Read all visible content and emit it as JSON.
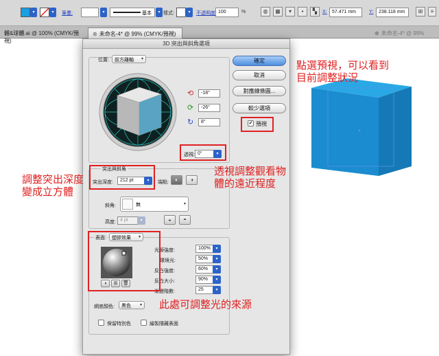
{
  "control_bar": {
    "stroke_label": "筆畫:",
    "stroke_weight_value": "",
    "style_value": "基本",
    "style_label": "樣式:",
    "opacity_label": "不透明度",
    "opacity_value": "100",
    "opacity_unit": "%",
    "x_label": "X:",
    "x_value": "57.471 mm",
    "y_label": "Y:",
    "y_value": "238.118 mm",
    "fill_color": "#1a9fe0"
  },
  "tabs": [
    {
      "label": "體&球體.ai @ 100% (CMYK/預視)"
    },
    {
      "label": "未命名-4* @ 99% (CMYK/預視)"
    },
    {
      "label": "未命名-4* @ 99%"
    }
  ],
  "dialog": {
    "title": "3D 突出與斜角選項",
    "position_label": "位置:",
    "position_value": "前方離軸",
    "rotation_x": "-18°",
    "rotation_y": "-26°",
    "rotation_z": "8°",
    "perspective_label": "透視:",
    "perspective_value": "0°",
    "extrude_group_label": "突出與斜角",
    "extrude_depth_label": "突出深度:",
    "extrude_depth_value": "212 pt",
    "cap_label": "端點:",
    "bevel_label": "斜角:",
    "bevel_value": "無",
    "height_label": "高度:",
    "height_value": "4 pt",
    "surface_label": "表面:",
    "surface_value": "塑膠效果",
    "light_intensity_label": "光源強度:",
    "light_intensity_value": "100%",
    "ambient_label": "環境光:",
    "ambient_value": "50%",
    "highlight_intensity_label": "反白強度:",
    "highlight_intensity_value": "60%",
    "highlight_size_label": "反白大小:",
    "highlight_size_value": "90%",
    "blend_steps_label": "漸變階數:",
    "blend_steps_value": "25",
    "shading_color_label": "網底顏色:",
    "shading_color_value": "黑色",
    "preserve_spot_label": "保留特別色",
    "draw_hidden_label": "繪製隱藏表面",
    "ok_label": "確定",
    "cancel_label": "取消",
    "map_art_label": "對應線條圖...",
    "fewer_options_label": "較少選項",
    "preview_label": "預視",
    "preview_checked": true
  },
  "annotations": {
    "preview_note": "點選預視，可以看到\n目前調整狀況",
    "depth_note": "調整突出深度\n變成立方體",
    "perspective_note": "透視調整觀看物\n體的遠近程度",
    "light_note": "此處可調整光的來源",
    "annotation_color": "#e02020"
  },
  "artwork": {
    "cube_color": "#1a9fe0"
  }
}
